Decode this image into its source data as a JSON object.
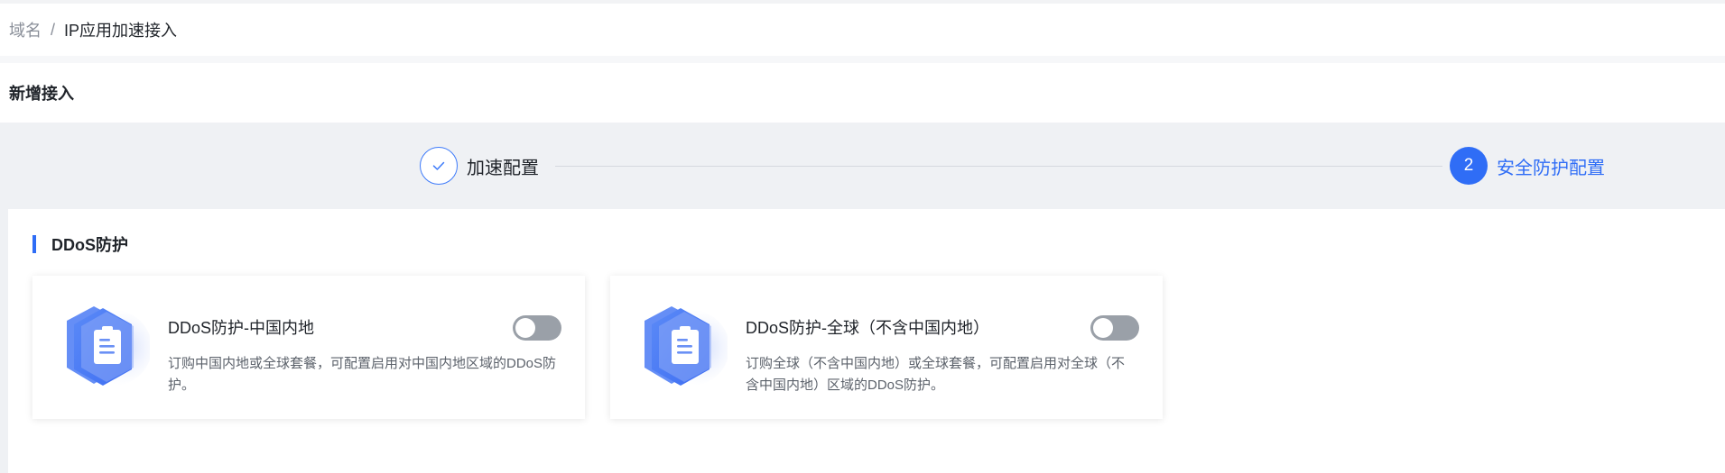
{
  "breadcrumb": {
    "parent": "域名",
    "separator": "/",
    "current": "IP应用加速接入"
  },
  "page": {
    "title": "新增接入"
  },
  "steps": [
    {
      "number": "1",
      "label": "加速配置",
      "status": "done"
    },
    {
      "number": "2",
      "label": "安全防护配置",
      "status": "active"
    }
  ],
  "section": {
    "title": "DDoS防护"
  },
  "cards": [
    {
      "title": "DDoS防护-中国内地",
      "description": "订购中国内地或全球套餐，可配置启用对中国内地区域的DDoS防护。",
      "enabled": false,
      "icon": "shield-document-icon"
    },
    {
      "title": "DDoS防护-全球（不含中国内地）",
      "description": "订购全球（不含中国内地）或全球套餐，可配置启用对全球（不含中国内地）区域的DDoS防护。",
      "enabled": false,
      "icon": "shield-document-icon"
    }
  ],
  "colors": {
    "accent": "#2f6df6",
    "toggle_off": "#9aa0a8",
    "background_gray": "#eff1f4"
  }
}
